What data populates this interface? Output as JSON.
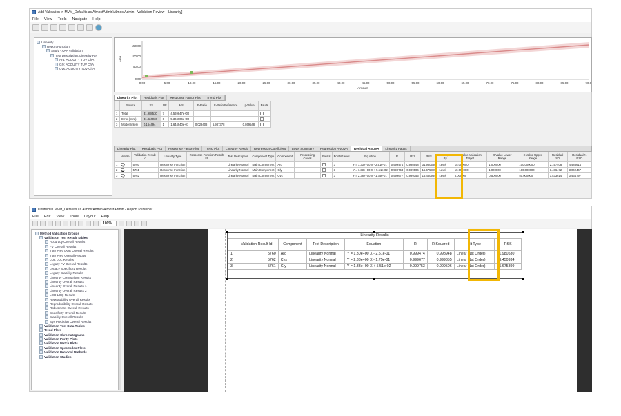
{
  "top": {
    "title": "Add Validation in MVM_Defaults as AlmostAdmin\\AlmostAdmin - Validation Review - [Linearity]",
    "menu": [
      "File",
      "View",
      "Tools",
      "Navigate",
      "Help"
    ],
    "tree": [
      "Linearity",
      "Report Function",
      "Study - AAA Validation",
      "Test Description: Linearity Re",
      "Arg: ACQUITY TUV ChA",
      "Gly: ACQUITY TUV ChA",
      "Cys: ACQUITY TUV ChA"
    ],
    "plot": {
      "y_ticks": [
        "150.00",
        "100.00",
        "50.00",
        "0.00"
      ],
      "x_ticks": [
        "0.00",
        "5.00",
        "10.00",
        "15.00",
        "20.00",
        "25.00",
        "30.00",
        "35.00",
        "40.00",
        "45.00",
        "50.00",
        "55.00",
        "60.00",
        "65.00",
        "70.00",
        "75.00",
        "80.00",
        "85.00",
        "90.00"
      ],
      "x_label": "Amount",
      "y_label": "Area"
    },
    "tabs1": [
      "Linearity Plot",
      "Residuals Plot",
      "Response Factor Plot",
      "Trend Plot"
    ],
    "anova": {
      "headers": [
        "Source",
        "SS",
        "DF",
        "MS",
        "F-Ratio",
        "F-Ratio Reference",
        "p-Value",
        "Faults"
      ],
      "rows": [
        [
          "Total",
          "31.988530",
          "7",
          "4.569847e+00",
          "",
          "",
          "",
          ""
        ],
        [
          "Error (intra)",
          "31.824036",
          "6",
          "5.304006e+00",
          "",
          "",
          "",
          ""
        ],
        [
          "Model (inter)",
          "0.164494",
          "1",
          "1.644940e-01",
          "0.029408",
          "5.987378",
          "0.869548",
          ""
        ]
      ]
    },
    "tabs2": [
      "Linearity Plot",
      "Residuals Plot",
      "Response Factor Plot",
      "Trend Plot",
      "Linearity Result",
      "Regression Coefficient",
      "Level Summary",
      "Regression ANOVA",
      "Residual ANOVA",
      "Linearity Faults"
    ],
    "results": {
      "headers": [
        "Visible",
        "Validation Result Id",
        "Linearity Type",
        "Response Function Result Id",
        "Test Description",
        "Component Type",
        "Component",
        "Processing Codes",
        "Faults",
        "Points/Level",
        "Equation",
        "R",
        "R^2",
        "RSS",
        "Group By",
        "X Value Validation Target",
        "X Value Lower Range",
        "X Value Upper Range",
        "Residual SD",
        "Residual % RSD"
      ],
      "rows": [
        [
          "5760",
          "Response Function",
          "",
          "Linearity Normal",
          "Main Component",
          "Arg",
          "",
          "",
          "3",
          "Y = 1.33e+00 X - 2.51e-01",
          "0.999474",
          "0.998948",
          "31.980530",
          "Level",
          "15.000000",
          "1.000000",
          "100.000000",
          "2.157408",
          "4.486614"
        ],
        [
          "5761",
          "Response Function",
          "",
          "Linearity Normal",
          "Main Component",
          "Gly",
          "",
          "",
          "3",
          "Y = 1.33e+00 X + 5.51e-02",
          "0.999753",
          "0.999506",
          "15.675899",
          "Level",
          "10.000000",
          "1.000000",
          "100.000000",
          "1.486472",
          "3.042467"
        ],
        [
          "5762",
          "Response Function",
          "",
          "Linearity Normal",
          "Main Component",
          "Cys",
          "",
          "",
          "3",
          "Y = 2.38e+00 X - 1.75e-01",
          "0.999677",
          "0.999355",
          "16.450934",
          "Level",
          "5.000000",
          "0.500000",
          "50.000000",
          "1.533614",
          "3.464797"
        ]
      ]
    }
  },
  "bottom": {
    "title": "Untitled in MVM_Defaults as AlmostAdmin\\AlmostAdmin - Report Publisher",
    "menu": [
      "File",
      "Edit",
      "View",
      "Tools",
      "Layout",
      "Help"
    ],
    "zoom": "100%",
    "tree": [
      "Method Validation Groups",
      "Validation Test Result Tables",
      "Accuracy Overall Results",
      "FV Overall Results",
      "Inter Prec DOE Overall Results",
      "Inter Prec Overall Results",
      "LOL LOL Results",
      "Legacy FV Overall Results",
      "Legacy Specificity Results",
      "Legacy Stability Results",
      "Linearity Comparison Results",
      "Linearity Overall Results",
      "Linearity Overall Results 1",
      "Linearity Overall Results 2",
      "LOD LOQ Results",
      "Repeatability Overall Results",
      "Reproducibility Overall Results",
      "Robustness Overall Results",
      "Specificity Overall Results",
      "Stability Overall Results",
      "Sys Precision Overall Results",
      "Validation Test Data Tables",
      "Trend Plots",
      "Validation Chromatograms",
      "Validation Purity Plots",
      "Validation Match Plots",
      "Validation Spec Index Plots",
      "Validation Protocol Methods",
      "Validation Studies"
    ],
    "report": {
      "title": "Linearity Results",
      "headers": [
        "Validation Result Id",
        "Component",
        "Test Description",
        "Equation",
        "R",
        "R Squared",
        "Fit Type",
        "RSS"
      ],
      "rows": [
        [
          "1",
          "5760",
          "Arg",
          "Linearity Normal",
          "Y = 1.30e+00 X - 2.51e-01",
          "0.999474",
          "0.998948",
          "Linear (1st Order)",
          "31.980530"
        ],
        [
          "2",
          "5762",
          "Cys",
          "Linearity Normal",
          "Y = 2.38e+00 X - 1.75e-01",
          "0.999677",
          "0.999355",
          "Linear (1st Order)",
          "16.450934"
        ],
        [
          "3",
          "5761",
          "Gly",
          "Linearity Normal",
          "Y = 1.33e+00 X + 5.51e-02",
          "0.999753",
          "0.999506",
          "Linear (1st Order)",
          "15.675899"
        ]
      ]
    }
  },
  "colors": {
    "highlight": "#f2b705",
    "plot_line": "#d98a8a",
    "plot_band": "#f3d6d6",
    "dark_panel": "#2e2e2e"
  }
}
